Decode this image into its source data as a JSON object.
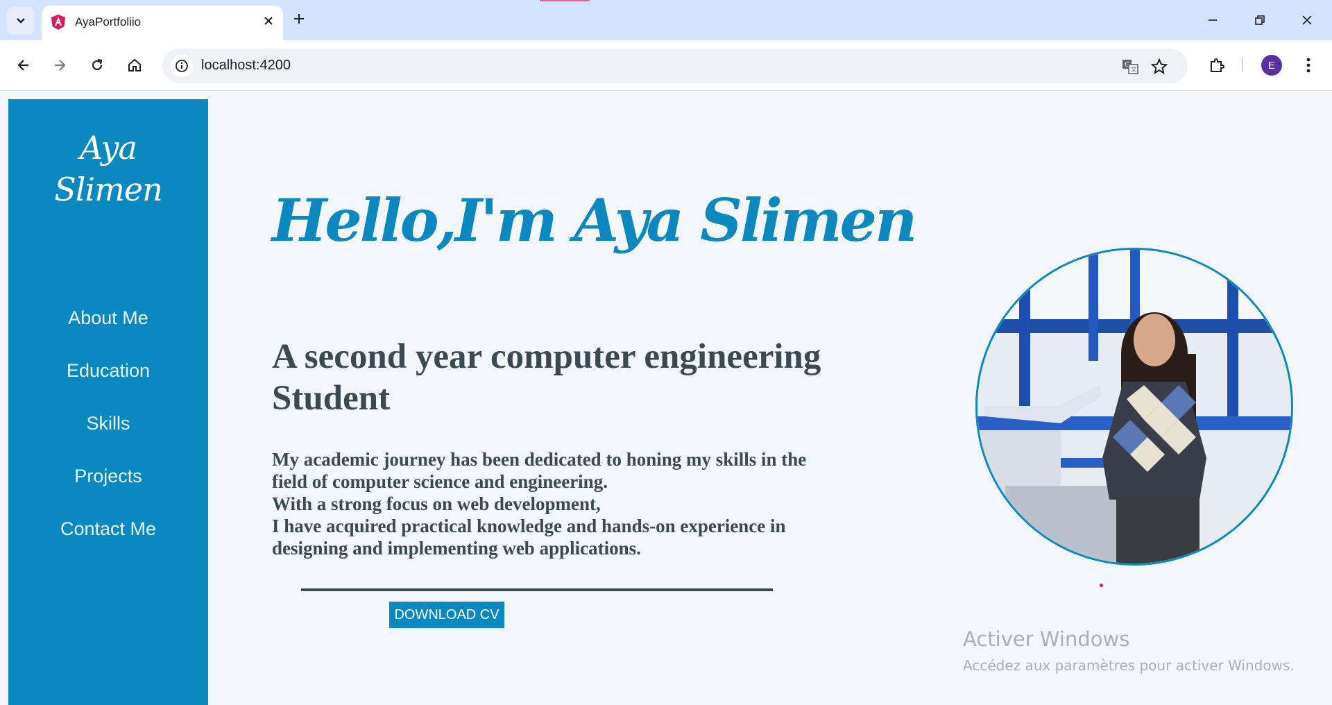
{
  "browser": {
    "tab_title": "AyaPortfoliio",
    "url": "localhost:4200",
    "profile_initial": "E",
    "icons": {
      "tab_search": "chevron-down-icon",
      "close_tab": "close-icon",
      "new_tab": "plus-icon",
      "back": "arrow-left-icon",
      "forward": "arrow-right-icon",
      "reload": "reload-icon",
      "home": "home-icon",
      "site_info": "info-icon",
      "translate": "translate-icon",
      "bookmark": "star-icon",
      "extensions": "puzzle-icon",
      "menu": "kebab-menu-icon",
      "minimize": "minimize-icon",
      "restore": "restore-icon",
      "close_window": "close-icon"
    }
  },
  "sidebar": {
    "brand_line1": "Aya",
    "brand_line2": "Slimen",
    "items": [
      {
        "label": "About Me"
      },
      {
        "label": "Education"
      },
      {
        "label": "Skills"
      },
      {
        "label": "Projects"
      },
      {
        "label": "Contact Me"
      }
    ]
  },
  "hero": {
    "title": "Hello,I'm Aya Slimen",
    "subtitle": "A second year computer engineering Student",
    "paragraph_lines": [
      "My academic journey has been dedicated to honing my skills in the",
      "field of computer science and engineering.",
      "With a strong focus on web development,",
      "I have acquired practical knowledge and hands-on experience in",
      "designing and implementing web applications."
    ],
    "cv_button": "DOWNLOAD CV"
  },
  "watermark": {
    "line1": "Activer Windows",
    "line2": "Accédez aux paramètres pour activer Windows."
  },
  "colors": {
    "accent": "#0b88bf",
    "text_dark": "#3b4a52",
    "background": "#f3f6fa",
    "tabbar": "#d3e3fd"
  }
}
